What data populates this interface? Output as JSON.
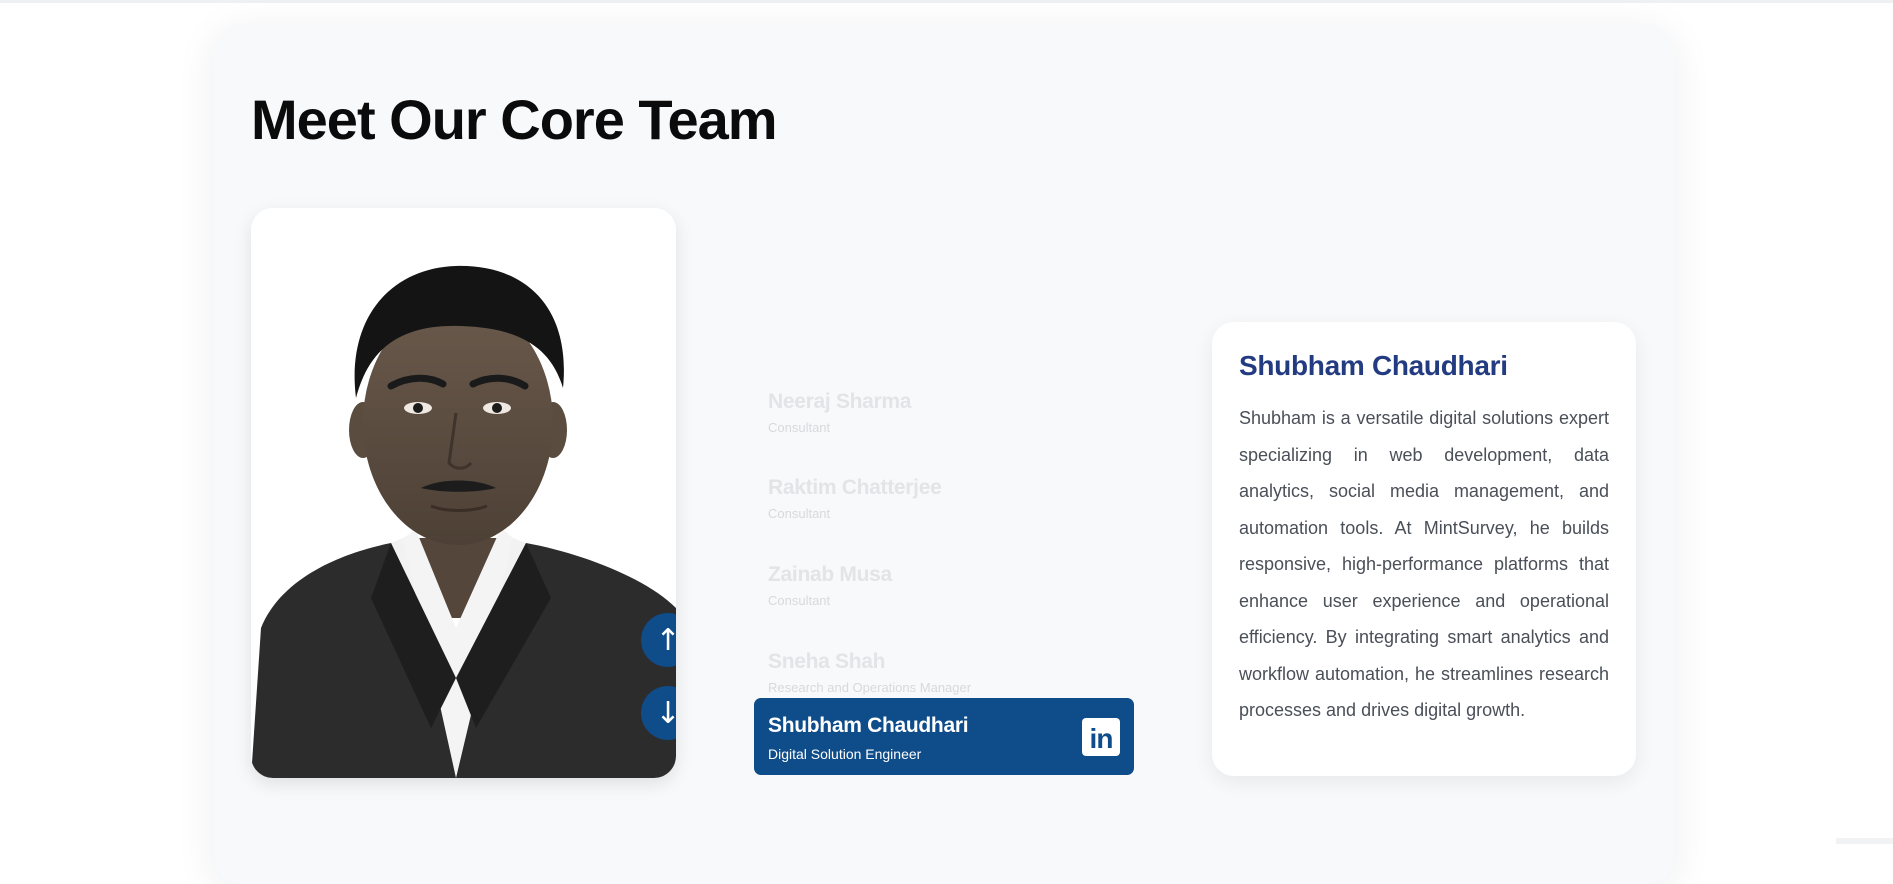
{
  "section": {
    "title": "Meet Our Core Team"
  },
  "navigation": {
    "up_icon": "↑",
    "down_icon": "↓"
  },
  "members": [
    {
      "name": "Neeraj Sharma",
      "role": "Consultant"
    },
    {
      "name": "Raktim Chatterjee",
      "role": "Consultant"
    },
    {
      "name": "Zainab Musa",
      "role": "Consultant"
    },
    {
      "name": "Sneha Shah",
      "role": "Research and Operations Manager"
    }
  ],
  "active_member": {
    "name": "Shubham Chaudhari",
    "role": "Digital Solution Engineer",
    "linkedin_icon": "in"
  },
  "bio": {
    "name": "Shubham Chaudhari",
    "text": "Shubham is a versatile digital solutions expert specializing in web development, data analytics, social media management, and automation tools. At MintSurvey, he builds responsive, high-performance platforms that enhance user experience and operational efficiency. By integrating smart analytics and workflow automation, he streamlines research processes and drives digital growth."
  },
  "colors": {
    "accent": "#0f4c8a",
    "bio_name": "#233b80",
    "inactive_text": "#e2e4e8"
  }
}
